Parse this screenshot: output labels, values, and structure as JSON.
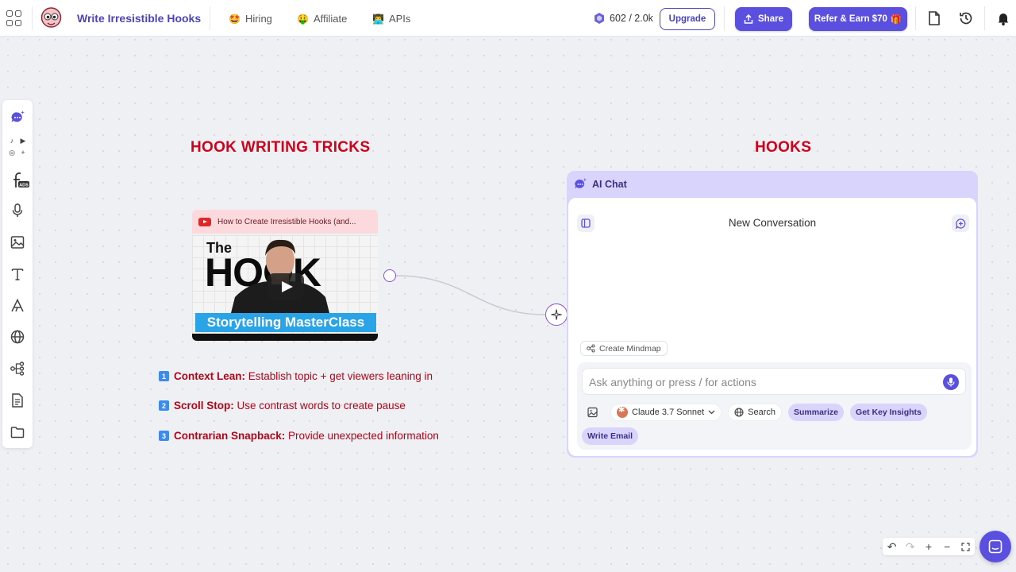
{
  "header": {
    "doc_title": "Write Irresistible Hooks",
    "nav": [
      {
        "label": "Hiring",
        "icon": "hiring-emoji-icon",
        "emoji": "🤩"
      },
      {
        "label": "Affiliate",
        "icon": "affiliate-emoji-icon",
        "emoji": "🤑"
      },
      {
        "label": "APIs",
        "icon": "apis-emoji-icon",
        "emoji": "👨‍💻"
      }
    ],
    "credits": "602 / 2.0k",
    "upgrade_label": "Upgrade",
    "share_label": "Share",
    "refer_label": "Refer & Earn $70",
    "refer_emoji": "🎁"
  },
  "left_toolbar": {
    "items": [
      "ai-chat-icon",
      "social-media-icons",
      "facebook-ads-icon",
      "microphone-icon",
      "image-icon",
      "text-icon",
      "font-icon",
      "globe-icon",
      "mindmap-icon",
      "document-icon",
      "folder-icon"
    ],
    "ads_label": "ADS"
  },
  "canvas": {
    "left_heading": "HOOK WRITING TRICKS",
    "right_heading": "HOOKS",
    "video": {
      "title": "How to Create Irresistible Hooks (and...",
      "thumb_the": "The",
      "thumb_hook": "HOOK",
      "thumb_banner": "Storytelling MasterClass"
    },
    "tricks": [
      {
        "num": "1",
        "bold": "Context Lean:",
        "text": " Establish topic + get viewers leaning in"
      },
      {
        "num": "2",
        "bold": "Scroll Stop:",
        "text": " Use contrast words to create pause"
      },
      {
        "num": "3",
        "bold": "Contrarian Snapback:",
        "text": " Provide unexpected information"
      }
    ]
  },
  "chat": {
    "header_label": "AI Chat",
    "title": "New Conversation",
    "mindmap_label": "Create Mindmap",
    "input_placeholder": "Ask anything or press / for actions",
    "model_label": "Claude 3.7 Sonnet",
    "search_label": "Search",
    "chips": [
      "Summarize",
      "Get Key Insights",
      "Write Email"
    ]
  },
  "colors": {
    "brand": "#5b4fe0",
    "heading_red": "#d0021b",
    "chat_bg": "#d9d4fb"
  }
}
